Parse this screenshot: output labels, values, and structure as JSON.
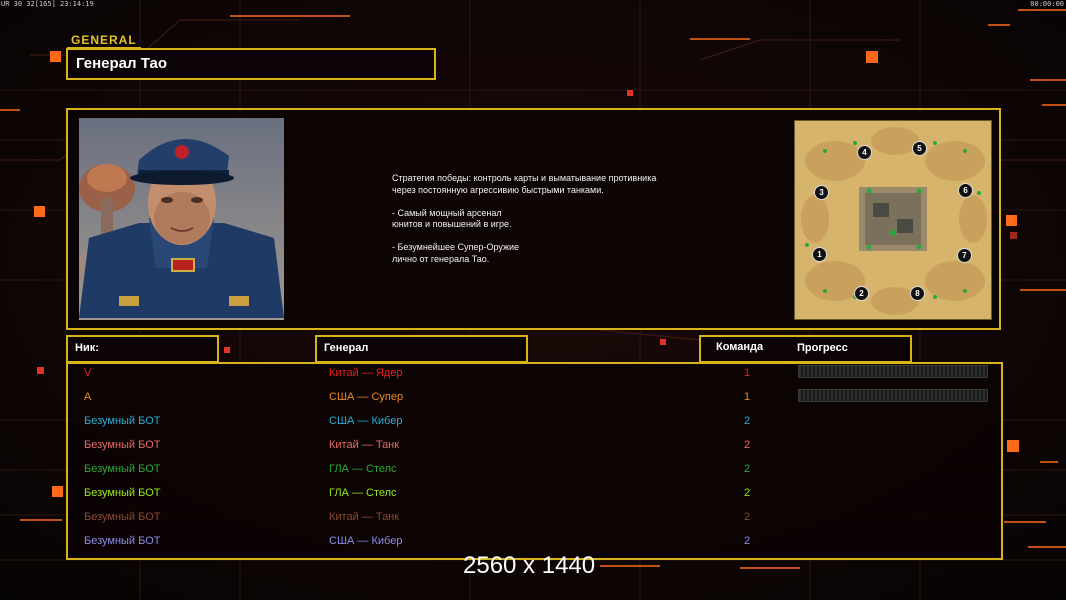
{
  "hud": {
    "top_left": "UR 30 32[165] 23:14:19",
    "top_right": "00:00:00"
  },
  "general_tag": "GENERAL",
  "title": "Генерал Тао",
  "description": "Стратегия победы: контроль карты и выматывание противника\n через постоянную агрессивию быстрыми танками.\n\n- Самый мощный арсенал\nюнитов и повышений в игре.\n\n- Безумнейшее Супер-Оружие\nлично от генерала Тао.",
  "colors": {
    "accent": "#d8b31a",
    "background": "#0a0505",
    "glow": "#ff5a14"
  },
  "headers": {
    "nick": "Ник:",
    "general": "Генерал",
    "team": "Команда",
    "progress": "Прогресс"
  },
  "minimap": {
    "spawns": [
      "4",
      "5",
      "3",
      "6",
      "1",
      "7",
      "2",
      "8"
    ]
  },
  "players": [
    {
      "nick": "V",
      "general": "Китай — Ядер",
      "team": "1",
      "color": "#e02020",
      "progress": 0
    },
    {
      "nick": "A",
      "general": "США — Супер",
      "team": "1",
      "color": "#e88a2a",
      "progress": 0
    },
    {
      "nick": "Безумный БОТ",
      "general": "США — Кибер",
      "team": "2",
      "color": "#2aaed8",
      "progress": null
    },
    {
      "nick": "Безумный БОТ",
      "general": "Китай — Танк",
      "team": "2",
      "color": "#e86a6a",
      "progress": null
    },
    {
      "nick": "Безумный БОТ",
      "general": "ГЛА — Стелс",
      "team": "2",
      "color": "#2ea83a",
      "progress": null
    },
    {
      "nick": "Безумный БОТ",
      "general": "ГЛА — Стелс",
      "team": "2",
      "color": "#9ae81e",
      "progress": null
    },
    {
      "nick": "Безумный БОТ",
      "general": "Китай — Танк",
      "team": "2",
      "color": "#8a4a34",
      "progress": null
    },
    {
      "nick": "Безумный БОТ",
      "general": "США — Кибер",
      "team": "2",
      "color": "#8c8ce8",
      "progress": null
    }
  ],
  "resolution_label": "2560 x 1440"
}
